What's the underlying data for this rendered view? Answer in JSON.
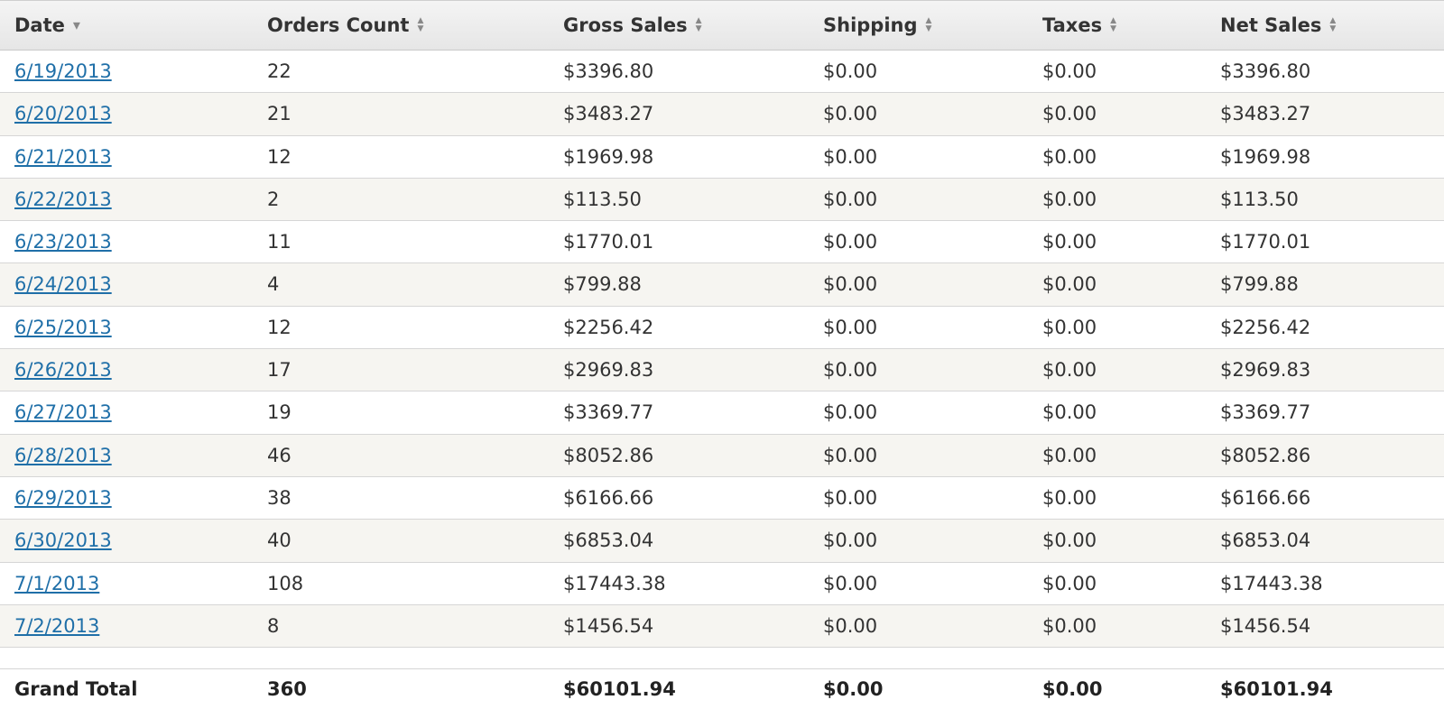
{
  "table": {
    "columns": [
      {
        "label": "Date",
        "sort": "desc"
      },
      {
        "label": "Orders Count",
        "sort": "none"
      },
      {
        "label": "Gross Sales",
        "sort": "none"
      },
      {
        "label": "Shipping",
        "sort": "none"
      },
      {
        "label": "Taxes",
        "sort": "none"
      },
      {
        "label": "Net Sales",
        "sort": "none"
      }
    ],
    "rows": [
      [
        "6/19/2013",
        "22",
        "$3396.80",
        "$0.00",
        "$0.00",
        "$3396.80"
      ],
      [
        "6/20/2013",
        "21",
        "$3483.27",
        "$0.00",
        "$0.00",
        "$3483.27"
      ],
      [
        "6/21/2013",
        "12",
        "$1969.98",
        "$0.00",
        "$0.00",
        "$1969.98"
      ],
      [
        "6/22/2013",
        "2",
        "$113.50",
        "$0.00",
        "$0.00",
        "$113.50"
      ],
      [
        "6/23/2013",
        "11",
        "$1770.01",
        "$0.00",
        "$0.00",
        "$1770.01"
      ],
      [
        "6/24/2013",
        "4",
        "$799.88",
        "$0.00",
        "$0.00",
        "$799.88"
      ],
      [
        "6/25/2013",
        "12",
        "$2256.42",
        "$0.00",
        "$0.00",
        "$2256.42"
      ],
      [
        "6/26/2013",
        "17",
        "$2969.83",
        "$0.00",
        "$0.00",
        "$2969.83"
      ],
      [
        "6/27/2013",
        "19",
        "$3369.77",
        "$0.00",
        "$0.00",
        "$3369.77"
      ],
      [
        "6/28/2013",
        "46",
        "$8052.86",
        "$0.00",
        "$0.00",
        "$8052.86"
      ],
      [
        "6/29/2013",
        "38",
        "$6166.66",
        "$0.00",
        "$0.00",
        "$6166.66"
      ],
      [
        "6/30/2013",
        "40",
        "$6853.04",
        "$0.00",
        "$0.00",
        "$6853.04"
      ],
      [
        "7/1/2013",
        "108",
        "$17443.38",
        "$0.00",
        "$0.00",
        "$17443.38"
      ],
      [
        "7/2/2013",
        "8",
        "$1456.54",
        "$0.00",
        "$0.00",
        "$1456.54"
      ]
    ],
    "total": [
      "Grand Total",
      "360",
      "$60101.94",
      "$0.00",
      "$0.00",
      "$60101.94"
    ]
  },
  "colors": {
    "link": "#1f6fa8",
    "alt_row": "#f6f5f1",
    "header_bg": "#e6e6e6",
    "text": "#333333"
  },
  "icons": {
    "sort_desc": "caret-down-icon",
    "sort_none": "sort-arrows-icon"
  }
}
